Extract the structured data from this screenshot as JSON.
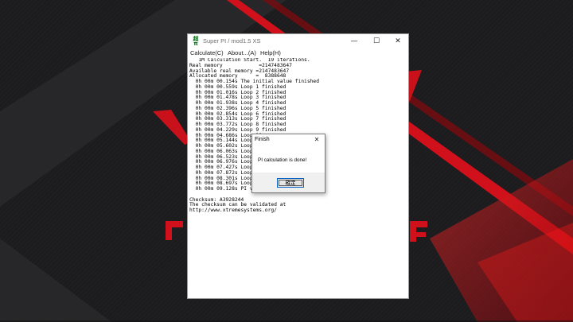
{
  "window": {
    "title": "Super PI / mod1.5 XS",
    "app_icon_text": "超π",
    "controls": {
      "minimize": "—",
      "maximize": "☐",
      "close": "✕"
    }
  },
  "menu": [
    {
      "label": "Calculate(C)"
    },
    {
      "label": "About...(A)"
    },
    {
      "label": "Help(H)"
    }
  ],
  "output": {
    "lines": [
      "   1M Calculation Start.  19 iterations.",
      "Real memory            =2147483647",
      "Available real memory =2147483647",
      "Allocated memory      =  8388648",
      "  0h 00m 00.154s The initial value finished",
      "  0h 00m 00.559s Loop 1 finished",
      "  0h 00m 01.016s Loop 2 finished",
      "  0h 00m 01.478s Loop 3 finished",
      "  0h 00m 01.938s Loop 4 finished",
      "  0h 00m 02.396s Loop 5 finished",
      "  0h 00m 02.854s Loop 6 finished",
      "  0h 00m 03.313s Loop 7 finished",
      "  0h 00m 03.772s Loop 8 finished",
      "  0h 00m 04.229s Loop 9 finished",
      "  0h 00m 04.686s Loop 10",
      "  0h 00m 05.144s Loop 11",
      "  0h 00m 05.602s Loop 12",
      "  0h 00m 06.063s Loop 13",
      "  0h 00m 06.523s Loop 14",
      "  0h 00m 06.976s Loop 15",
      "  0h 00m 07.427s Loop 16",
      "  0h 00m 07.872s Loop 17",
      "  0h 00m 08.301s Loop 18",
      "  0h 00m 08.697s Loop 19",
      "  0h 00m 09.128s PI vali",
      "",
      "Checksum: A3928244",
      "The checksum can be validated at",
      "http://www.xtremesystems.org/"
    ]
  },
  "dialog": {
    "title": "Finish",
    "close": "✕",
    "message": "PI calculation is done!",
    "ok_label": "確定"
  },
  "colors": {
    "desktop_dark": "#1c1c1e",
    "accent_red": "#e3101a",
    "window_bg": "#ffffff",
    "dialog_footer": "#f0f0f0",
    "focus_blue": "#0a64c8"
  }
}
